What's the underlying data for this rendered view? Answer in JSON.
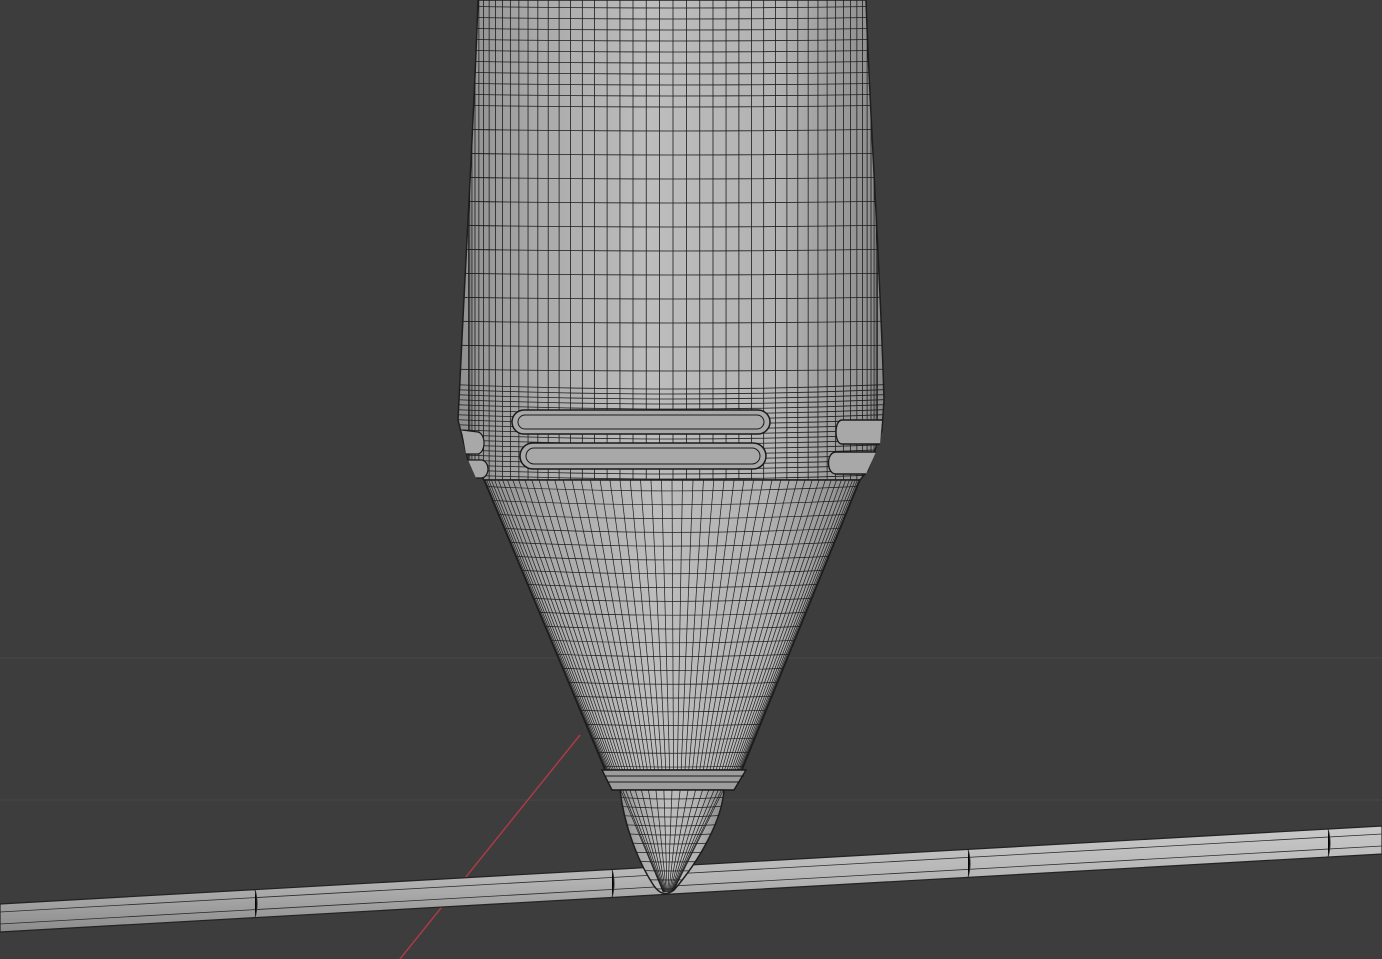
{
  "viewport": {
    "mode": "wireframe-overlay",
    "background_color": "#3d3d3d",
    "mesh_fill_color": "#b5b5b5",
    "wire_color": "#1c1c1c",
    "x_axis_color": "#b03a48",
    "grid_color": "#474747"
  },
  "objects": {
    "pen_model": "pen-body-mesh",
    "pen_tip": "pen-tip-mesh",
    "rod": "horizontal-rod-mesh",
    "axis": "x-axis-line"
  }
}
